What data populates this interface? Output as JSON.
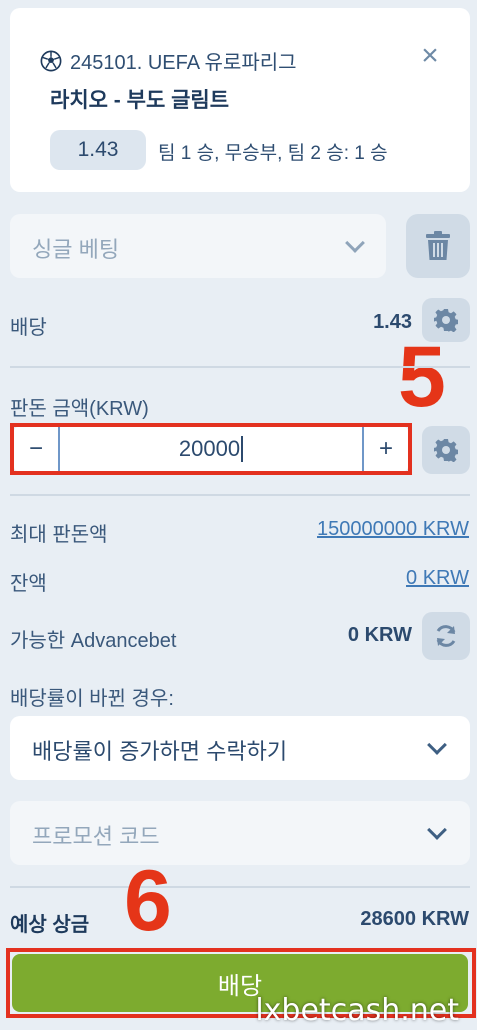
{
  "event": {
    "match_line": "245101. UEFA 유로파리그",
    "teams": "라치오 - 부도 글림트",
    "odds": "1.43",
    "market": "팀 1 승, 무승부, 팀 2 승: 1 승",
    "ball_icon": "soccer-ball-icon",
    "close_icon": "close-icon"
  },
  "bet_type": {
    "label": "싱글 베팅",
    "trash_icon": "trash-icon"
  },
  "coefficient": {
    "label": "배당",
    "value": "1.43"
  },
  "stake": {
    "label": "판돈 금액(KRW)",
    "minus": "−",
    "plus": "+",
    "value": "20000"
  },
  "limits": {
    "max_label": "최대 판돈액",
    "max_value": "150000000 KRW",
    "balance_label": "잔액",
    "balance_value": "0 KRW",
    "advancebet_label": "가능한 Advancebet",
    "advancebet_value": "0 KRW"
  },
  "odds_change": {
    "label": "배당률이 바뀐 경우:",
    "selected": "배당률이 증가하면 수락하기"
  },
  "promo": {
    "placeholder": "프로모션 코드"
  },
  "potential": {
    "label": "예상 상금",
    "value": "28600 KRW"
  },
  "place_button": {
    "label": "배당"
  },
  "annotations": {
    "step5": "5",
    "step6": "6"
  },
  "watermark": "lxbetcash.net",
  "colors": {
    "background": "#e8eef4",
    "accent_green": "#7dab2f",
    "highlight_red": "#e3311f",
    "link_blue": "#3f79b6"
  }
}
